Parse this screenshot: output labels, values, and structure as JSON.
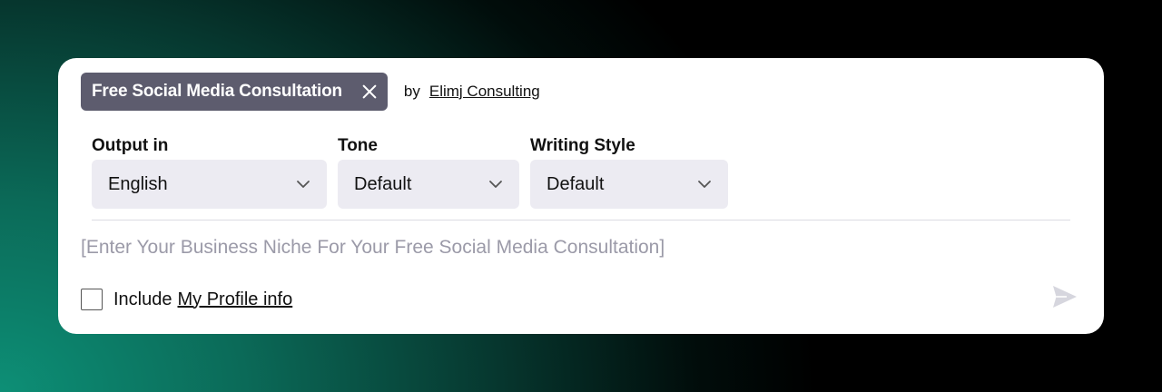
{
  "prompt": {
    "title": "Free Social Media Consultation",
    "by_label": "by",
    "author": "Elimj Consulting"
  },
  "selects": [
    {
      "label": "Output in",
      "value": "English"
    },
    {
      "label": "Tone",
      "value": "Default"
    },
    {
      "label": "Writing Style",
      "value": "Default"
    }
  ],
  "input": {
    "placeholder": "[Enter Your Business Niche For Your Free Social Media Consultation]",
    "value": ""
  },
  "include": {
    "prefix": "Include",
    "link": "My Profile info",
    "checked": false
  },
  "icons": {
    "close": "close-icon",
    "chevron": "chevron-down-icon",
    "send": "send-icon"
  },
  "colors": {
    "chip_bg": "#5d5c6e",
    "select_bg": "#ecebf2",
    "placeholder": "#9b9aa8",
    "send_icon": "#d6d6de"
  }
}
